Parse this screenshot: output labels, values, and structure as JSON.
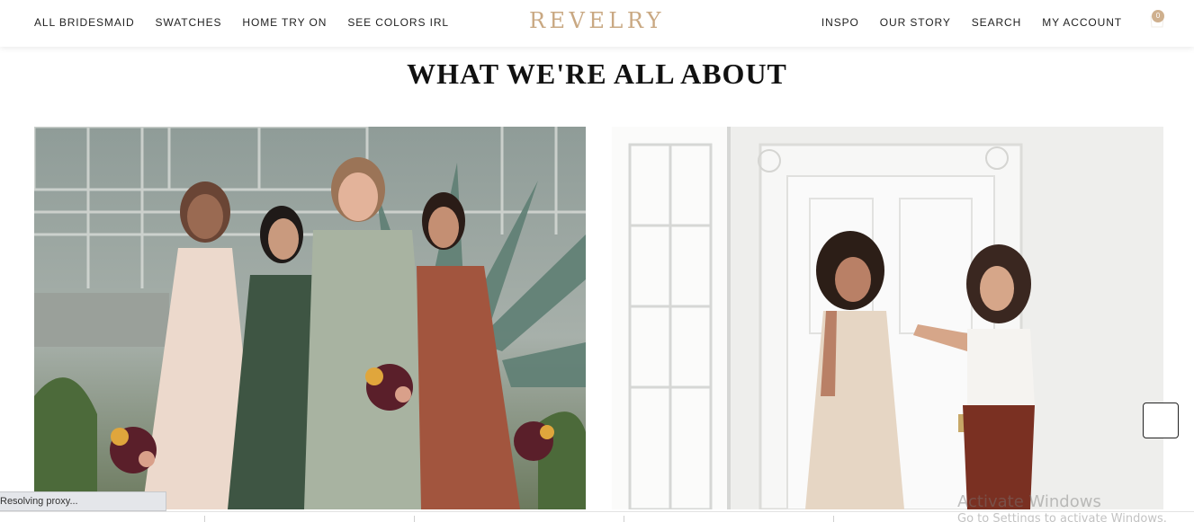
{
  "header": {
    "logo": "REVELRY",
    "nav_left": [
      {
        "label": "ALL BRIDESMAID",
        "name": "nav-all-bridesmaid"
      },
      {
        "label": "SWATCHES",
        "name": "nav-swatches"
      },
      {
        "label": "HOME TRY ON",
        "name": "nav-home-try-on"
      },
      {
        "label": "SEE COLORS IRL",
        "name": "nav-see-colors-irl"
      }
    ],
    "nav_right": [
      {
        "label": "INSPO",
        "name": "nav-inspo"
      },
      {
        "label": "OUR STORY",
        "name": "nav-our-story"
      },
      {
        "label": "SEARCH",
        "name": "nav-search"
      },
      {
        "label": "MY ACCOUNT",
        "name": "nav-my-account"
      }
    ],
    "cart_count": "0",
    "cart_icon": "shopping-bag-icon"
  },
  "section": {
    "title": "WHAT WE'RE ALL ABOUT"
  },
  "images": {
    "left_alt": "four-bridesmaids-photo",
    "right_alt": "bride-getting-dressed-photo"
  },
  "status_bar": {
    "text": "Resolving proxy..."
  },
  "watermark": {
    "title": "Activate Windows",
    "subtitle": "Go to Settings to activate Windows."
  },
  "colors": {
    "brand_gold": "#c9a882",
    "badge": "#cfb08e",
    "text": "#222222"
  }
}
